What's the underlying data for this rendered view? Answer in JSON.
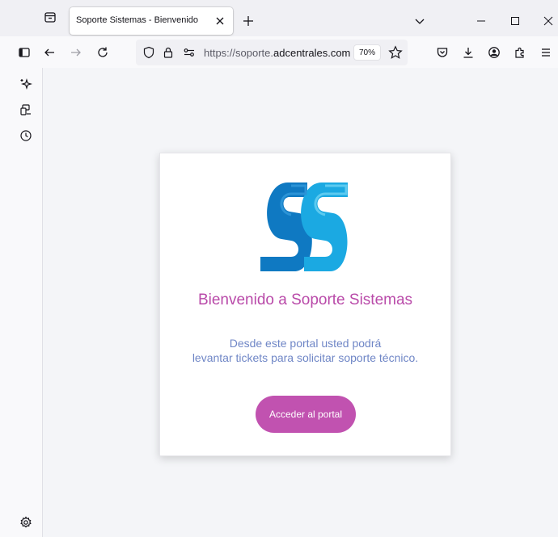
{
  "browser": {
    "tab": {
      "title": "Soporte Sistemas - Bienvenido"
    },
    "url": {
      "prefix": "https://soporte.",
      "host": "adcentrales.com"
    },
    "zoom": "70%"
  },
  "page": {
    "welcome": "Bienvenido a Soporte Sistemas",
    "description_line1": "Desde este portal usted podrá",
    "description_line2": "levantar tickets para solicitar soporte técnico.",
    "button_label": "Acceder al portal"
  },
  "colors": {
    "accent": "#c152b0",
    "welcome_text": "#b94aa9",
    "description_text": "#6f86c6",
    "logo_blue_dark": "#0f79c2",
    "logo_blue_light": "#1ba9e2"
  },
  "icons": [
    "tab-list-icon",
    "close-icon",
    "plus-icon",
    "chevron-down-icon",
    "minimize-icon",
    "maximize-icon",
    "window-close-icon",
    "sidebar-toggle-icon",
    "back-icon",
    "forward-icon",
    "reload-icon",
    "shield-icon",
    "lock-icon",
    "permissions-icon",
    "bookmark-star-icon",
    "pocket-icon",
    "download-icon",
    "account-icon",
    "extensions-icon",
    "menu-icon",
    "ai-sparkle-icon",
    "synced-tabs-icon",
    "history-icon",
    "settings-icon"
  ]
}
